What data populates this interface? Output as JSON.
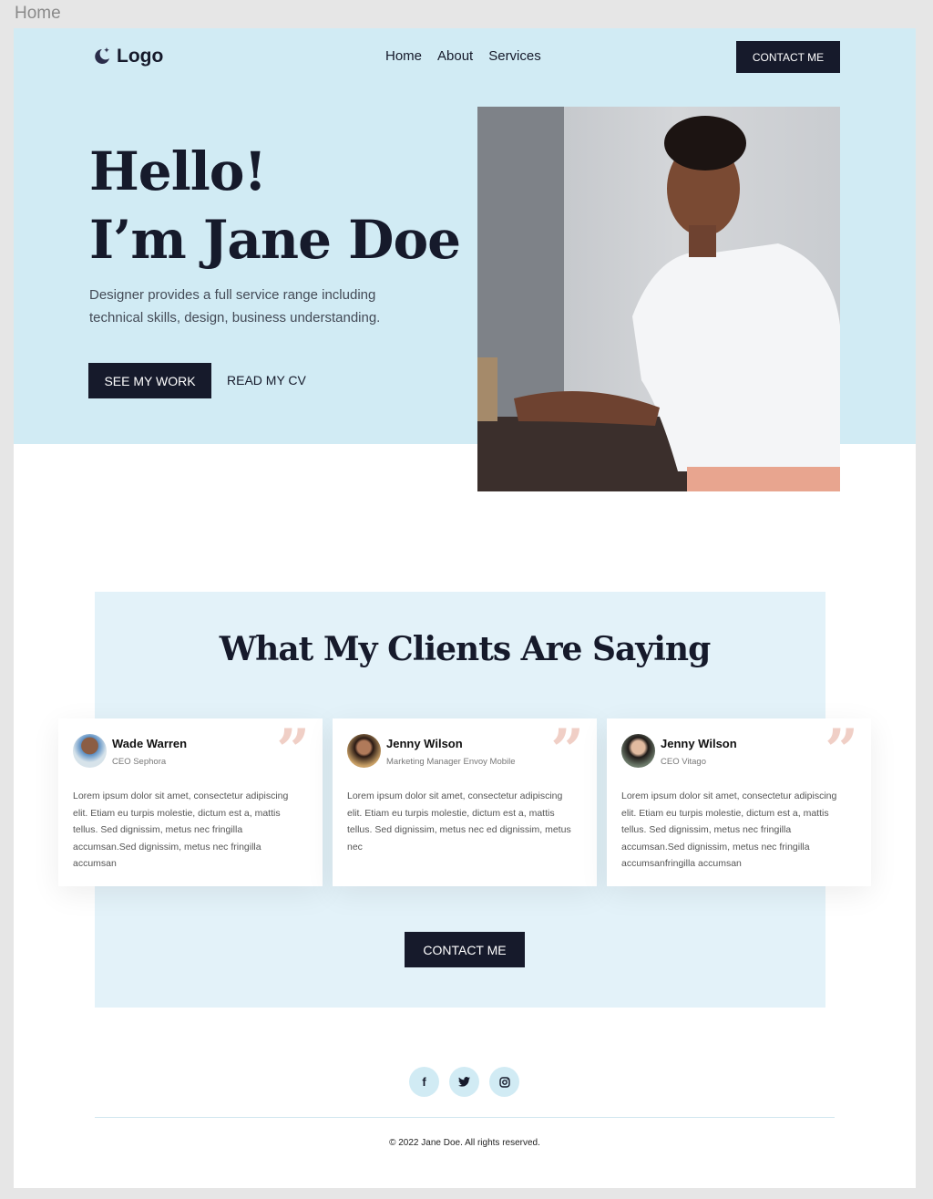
{
  "tab_title": "Home",
  "header": {
    "logo": "Logo",
    "nav": [
      "Home",
      "About",
      "Services"
    ],
    "contact_label": "CONTACT ME"
  },
  "hero": {
    "title_line1": "Hello!",
    "title_line2": "I’m Jane Doe",
    "description": "Designer provides a full service range including technical skills, design, business understanding.",
    "primary_button": "SEE MY WORK",
    "secondary_link": "READ MY CV"
  },
  "testimonials": {
    "heading": "What My Clients Are Saying",
    "items": [
      {
        "name": "Wade Warren",
        "role": "CEO Sephora",
        "text": "Lorem ipsum dolor sit amet, consectetur adipiscing elit. Etiam eu turpis molestie, dictum est a, mattis tellus. Sed dignissim, metus nec fringilla accumsan.Sed dignissim, metus nec fringilla accumsan"
      },
      {
        "name": "Jenny Wilson",
        "role": "Marketing Manager  Envoy Mobile",
        "text": "Lorem ipsum dolor sit amet, consectetur adipiscing elit. Etiam eu turpis molestie, dictum est a, mattis tellus. Sed dignissim, metus nec ed dignissim, metus nec"
      },
      {
        "name": "Jenny Wilson",
        "role": "CEO Vitago",
        "text": "Lorem ipsum dolor sit amet, consectetur adipiscing elit. Etiam eu turpis molestie, dictum est a, mattis tellus. Sed dignissim, metus nec fringilla accumsan.Sed dignissim, metus nec fringilla accumsanfringilla accumsan"
      }
    ],
    "contact_label": "CONTACT ME"
  },
  "footer": {
    "social": [
      "facebook-icon",
      "twitter-icon",
      "instagram-icon"
    ],
    "copyright": "© 2022 Jane Doe. All rights reserved."
  },
  "colors": {
    "hero_bg": "#d1ebf4",
    "section_bg": "#e3f2f9",
    "dark": "#161a2b",
    "quote": "#f0cfc6"
  }
}
